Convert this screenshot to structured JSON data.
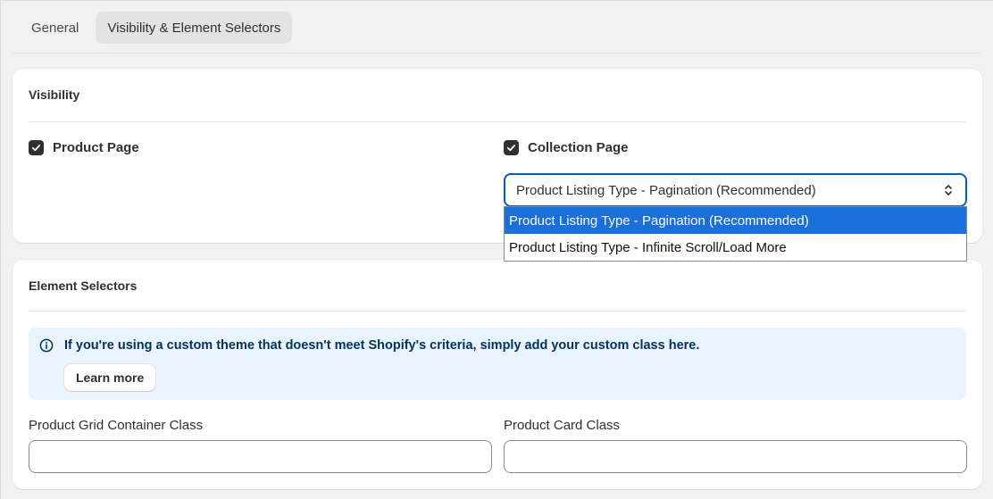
{
  "tabs": [
    {
      "label": "General",
      "active": false
    },
    {
      "label": "Visibility & Element Selectors",
      "active": true
    }
  ],
  "visibility": {
    "title": "Visibility",
    "product_page": {
      "label": "Product Page",
      "checked": true
    },
    "collection_page": {
      "label": "Collection Page",
      "checked": true
    },
    "listing_type": {
      "selected": "Product Listing Type - Pagination (Recommended)",
      "options": [
        "Product Listing Type - Pagination (Recommended)",
        "Product Listing Type - Infinite Scroll/Load More"
      ]
    }
  },
  "selectors": {
    "title": "Element Selectors",
    "banner": {
      "text": "If you're using a custom theme that doesn't meet Shopify's criteria, simply add your custom class here.",
      "button": "Learn more",
      "icon": "info-icon"
    },
    "grid_container": {
      "label": "Product Grid Container Class",
      "value": "",
      "placeholder": ""
    },
    "card_class": {
      "label": "Product Card Class",
      "value": "",
      "placeholder": ""
    }
  },
  "colors": {
    "accent": "#005bd3",
    "banner_bg": "#eaf4ff",
    "banner_text": "#00325e",
    "selected_option": "#1a6fdc"
  }
}
